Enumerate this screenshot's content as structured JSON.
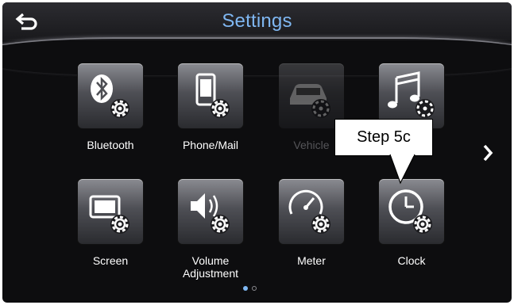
{
  "header": {
    "title": "Settings",
    "back_icon": "back-arrow-icon"
  },
  "settings_items": [
    {
      "label": "Bluetooth",
      "icon": "bluetooth-icon",
      "enabled": true
    },
    {
      "label": "Phone/Mail",
      "icon": "phone-icon",
      "enabled": true
    },
    {
      "label": "Vehicle",
      "icon": "car-icon",
      "enabled": false
    },
    {
      "label": "",
      "icon": "music-note-icon",
      "enabled": true
    },
    {
      "label": "Screen",
      "icon": "screen-icon",
      "enabled": true
    },
    {
      "label": "Volume Adjustment",
      "label_line1": "Volume",
      "label_line2": "Adjustment",
      "icon": "speaker-icon",
      "enabled": true
    },
    {
      "label": "Meter",
      "icon": "meter-icon",
      "enabled": true
    },
    {
      "label": "Clock",
      "icon": "clock-icon",
      "enabled": true
    }
  ],
  "navigation": {
    "next_icon": "chevron-right-icon",
    "page_count": 2,
    "current_page": 1
  },
  "annotation": {
    "text": "Step 5c"
  },
  "colors": {
    "title": "#7fb7f2",
    "background": "#0d0d0f",
    "label": "#ffffff",
    "active_dot": "#7fb7f2"
  }
}
